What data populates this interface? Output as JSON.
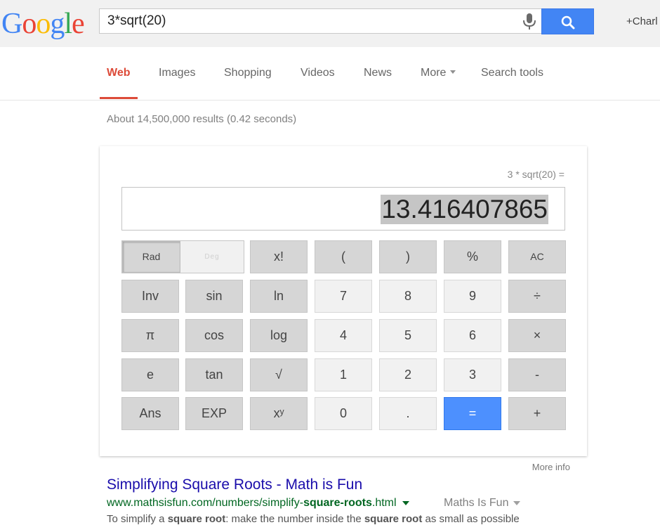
{
  "logo": {
    "letters": [
      "G",
      "o",
      "o",
      "g",
      "l",
      "e"
    ],
    "colors": [
      "#4285f4",
      "#ea4335",
      "#fbbc05",
      "#4285f4",
      "#34a853",
      "#ea4335"
    ]
  },
  "search": {
    "query": "3*sqrt(20)",
    "mic_icon": "microphone-icon",
    "search_icon": "magnifier-icon"
  },
  "user": {
    "label": "+Charl"
  },
  "tabs": [
    {
      "label": "Web",
      "active": true
    },
    {
      "label": "Images"
    },
    {
      "label": "Shopping"
    },
    {
      "label": "Videos"
    },
    {
      "label": "News"
    },
    {
      "label": "More",
      "dropdown": true
    },
    {
      "label": "Search tools"
    }
  ],
  "result_stats": "About 14,500,000 results (0.42 seconds)",
  "calculator": {
    "expression": "3 * sqrt(20) =",
    "display_value": "13.416407865",
    "keys": {
      "rad": "Rad",
      "deg": "Deg",
      "fact": "x!",
      "lparen": "(",
      "rparen": ")",
      "percent": "%",
      "ac": "AC",
      "inv": "Inv",
      "sin": "sin",
      "ln": "ln",
      "seven": "7",
      "eight": "8",
      "nine": "9",
      "divide": "÷",
      "pi": "π",
      "cos": "cos",
      "log": "log",
      "four": "4",
      "five": "5",
      "six": "6",
      "multiply": "×",
      "e": "e",
      "tan": "tan",
      "sqrt": "√",
      "one": "1",
      "two": "2",
      "three": "3",
      "minus": "-",
      "ans": "Ans",
      "exp": "EXP",
      "power": "xʸ",
      "zero": "0",
      "dot": ".",
      "equals": "=",
      "plus": "+"
    }
  },
  "more_info": "More info",
  "result": {
    "title": "Simplifying Square Roots - Math is Fun",
    "url_prefix": "www.mathsisfun.com/numbers/simplify-",
    "url_bold": "square-roots",
    "url_suffix": ".html",
    "source": "Maths Is Fun",
    "snippet_1": "To simplify a ",
    "snippet_b1": "square root",
    "snippet_2": ": make the number inside the ",
    "snippet_b2": "square root",
    "snippet_3": " as small as possible"
  },
  "colors": {
    "accent_red": "#dd4b39",
    "search_blue": "#4285f4",
    "link_blue": "#1a0dab",
    "url_green": "#006621"
  }
}
